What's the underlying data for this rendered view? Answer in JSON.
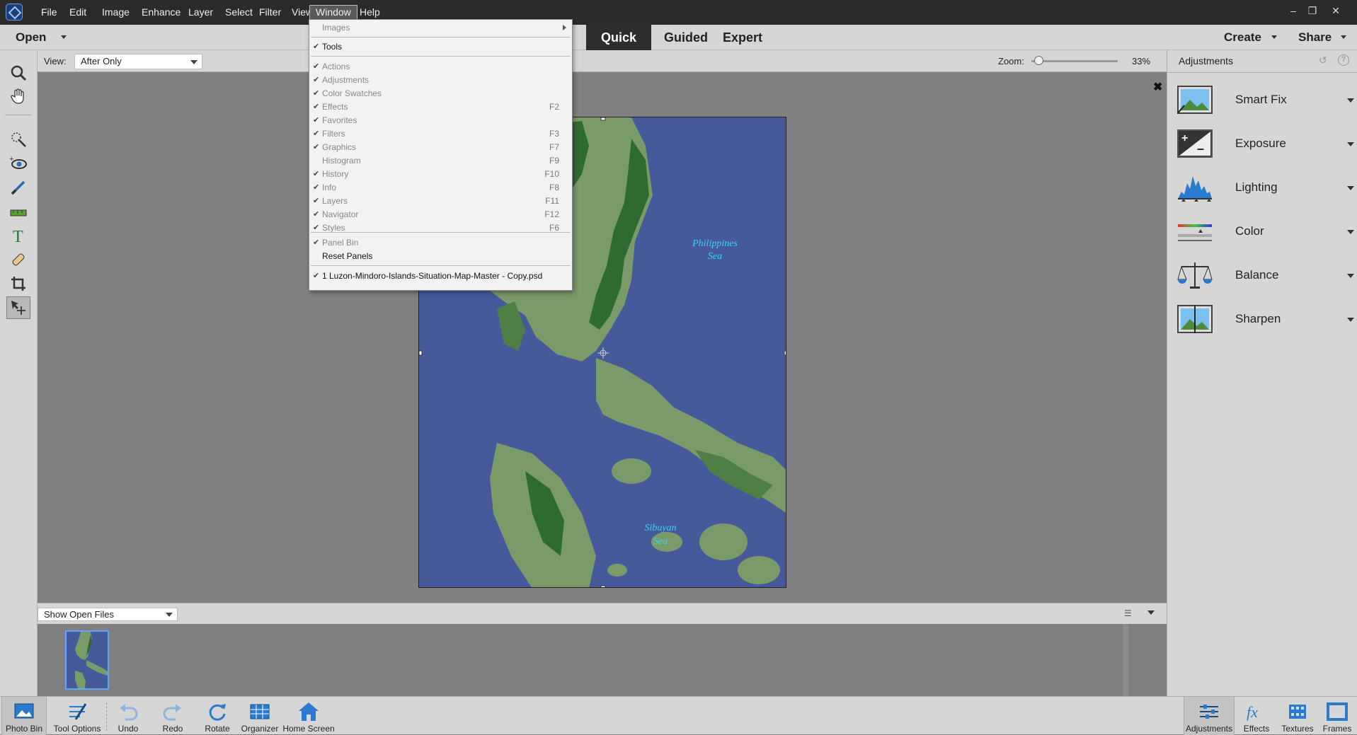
{
  "menubar": {
    "items": [
      "File",
      "Edit",
      "Image",
      "Enhance",
      "Layer",
      "Select",
      "Filter",
      "View",
      "Window",
      "Help"
    ],
    "active": "Window"
  },
  "modebar": {
    "open_label": "Open",
    "modes": [
      "Quick",
      "Guided",
      "Expert"
    ],
    "selected_mode": "Quick",
    "create_label": "Create",
    "share_label": "Share"
  },
  "options": {
    "view_label": "View:",
    "view_value": "After Only",
    "zoom_label": "Zoom:",
    "zoom_value": "33%",
    "zoom_fraction": 0.08
  },
  "window_menu": {
    "images": "Images",
    "tools": "Tools",
    "panels": [
      {
        "label": "Actions",
        "checked": true,
        "shortcut": ""
      },
      {
        "label": "Adjustments",
        "checked": true,
        "shortcut": ""
      },
      {
        "label": "Color Swatches",
        "checked": true,
        "shortcut": ""
      },
      {
        "label": "Effects",
        "checked": true,
        "shortcut": "F2"
      },
      {
        "label": "Favorites",
        "checked": true,
        "shortcut": ""
      },
      {
        "label": "Filters",
        "checked": true,
        "shortcut": "F3"
      },
      {
        "label": "Graphics",
        "checked": true,
        "shortcut": "F7"
      },
      {
        "label": "Histogram",
        "checked": false,
        "shortcut": "F9"
      },
      {
        "label": "History",
        "checked": true,
        "shortcut": "F10"
      },
      {
        "label": "Info",
        "checked": true,
        "shortcut": "F8"
      },
      {
        "label": "Layers",
        "checked": true,
        "shortcut": "F11"
      },
      {
        "label": "Navigator",
        "checked": true,
        "shortcut": "F12"
      },
      {
        "label": "Styles",
        "checked": true,
        "shortcut": "F6"
      }
    ],
    "panel_bin": "Panel Bin",
    "reset_panels": "Reset Panels",
    "open_file": "1 Luzon-Mindoro-Islands-Situation-Map-Master - Copy.psd"
  },
  "map": {
    "labels": [
      "Philippines",
      "Sea",
      "Sibuyan",
      "Sea"
    ]
  },
  "right_panel": {
    "title": "Adjustments",
    "items": [
      "Smart Fix",
      "Exposure",
      "Lighting",
      "Color",
      "Balance",
      "Sharpen"
    ]
  },
  "bin": {
    "dropdown": "Show Open Files"
  },
  "taskbar": {
    "left": [
      "Photo Bin",
      "Tool Options",
      "Undo",
      "Redo",
      "Rotate",
      "Organizer",
      "Home Screen"
    ],
    "right": [
      "Adjustments",
      "Effects",
      "Textures",
      "Frames"
    ]
  },
  "colors": {
    "accent": "#1c3f74",
    "map_water": "#46599a",
    "map_land": "#7a9a6a",
    "map_forest": "#2f6a31",
    "map_label": "#36d6f0"
  }
}
